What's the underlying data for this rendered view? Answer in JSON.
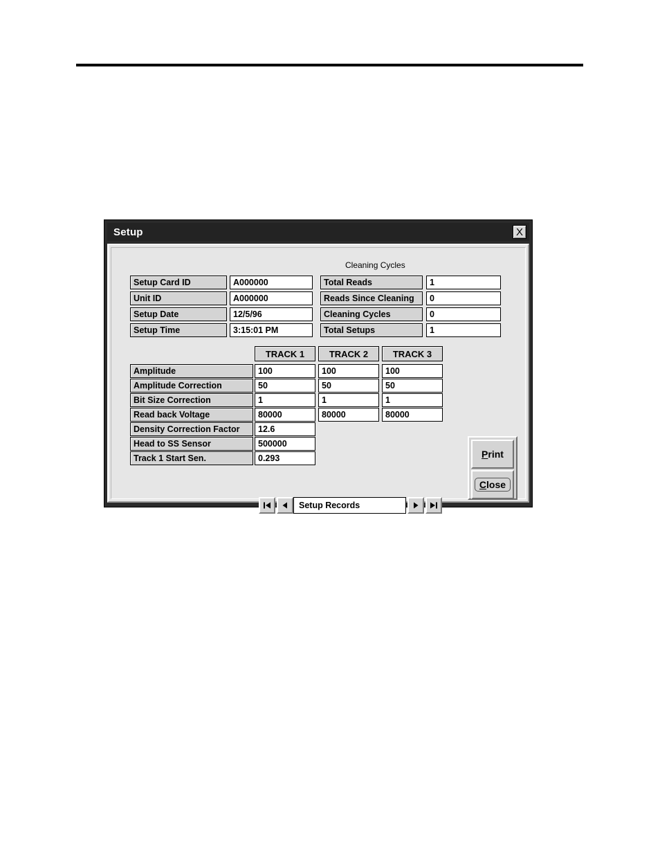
{
  "page": {
    "rule": "horizontal-rule"
  },
  "dialog": {
    "title": "Setup",
    "close_icon": "X",
    "group_label": "Cleaning Cycles",
    "left_fields": [
      {
        "label": "Setup Card ID",
        "value": "A000000"
      },
      {
        "label": "Unit ID",
        "value": "A000000"
      },
      {
        "label": "Setup Date",
        "value": "12/5/96"
      },
      {
        "label": "Setup Time",
        "value": "3:15:01 PM"
      }
    ],
    "right_fields": [
      {
        "label": "Total Reads",
        "value": "1"
      },
      {
        "label": "Reads Since Cleaning",
        "value": "0"
      },
      {
        "label": "Cleaning Cycles",
        "value": "0"
      },
      {
        "label": "Total Setups",
        "value": "1"
      }
    ],
    "track_headers": [
      "TRACK 1",
      "TRACK 2",
      "TRACK 3"
    ],
    "track_rows": [
      {
        "label": "Amplitude",
        "values": [
          "100",
          "100",
          "100"
        ]
      },
      {
        "label": "Amplitude Correction",
        "values": [
          "50",
          "50",
          "50"
        ]
      },
      {
        "label": "Bit Size Correction",
        "values": [
          "1",
          "1",
          "1"
        ]
      },
      {
        "label": "Read back Voltage",
        "values": [
          "80000",
          "80000",
          "80000"
        ]
      },
      {
        "label": "Density Correction Factor",
        "values": [
          "12.6",
          "",
          ""
        ]
      },
      {
        "label": "Head to SS Sensor",
        "values": [
          "500000",
          "",
          ""
        ]
      },
      {
        "label": "Track 1 Start Sen.",
        "values": [
          "0.293",
          "",
          ""
        ]
      }
    ],
    "buttons": {
      "print": {
        "pre": "P",
        "mnemonic": "P",
        "post": "rint",
        "label": "Print"
      },
      "close": {
        "pre": "",
        "mnemonic": "C",
        "post": "lose",
        "label": "Close"
      }
    },
    "navigator": {
      "label": "Setup Records",
      "first_icon": "first-record-icon",
      "prev_icon": "previous-record-icon",
      "next_icon": "next-record-icon",
      "last_icon": "last-record-icon"
    }
  }
}
